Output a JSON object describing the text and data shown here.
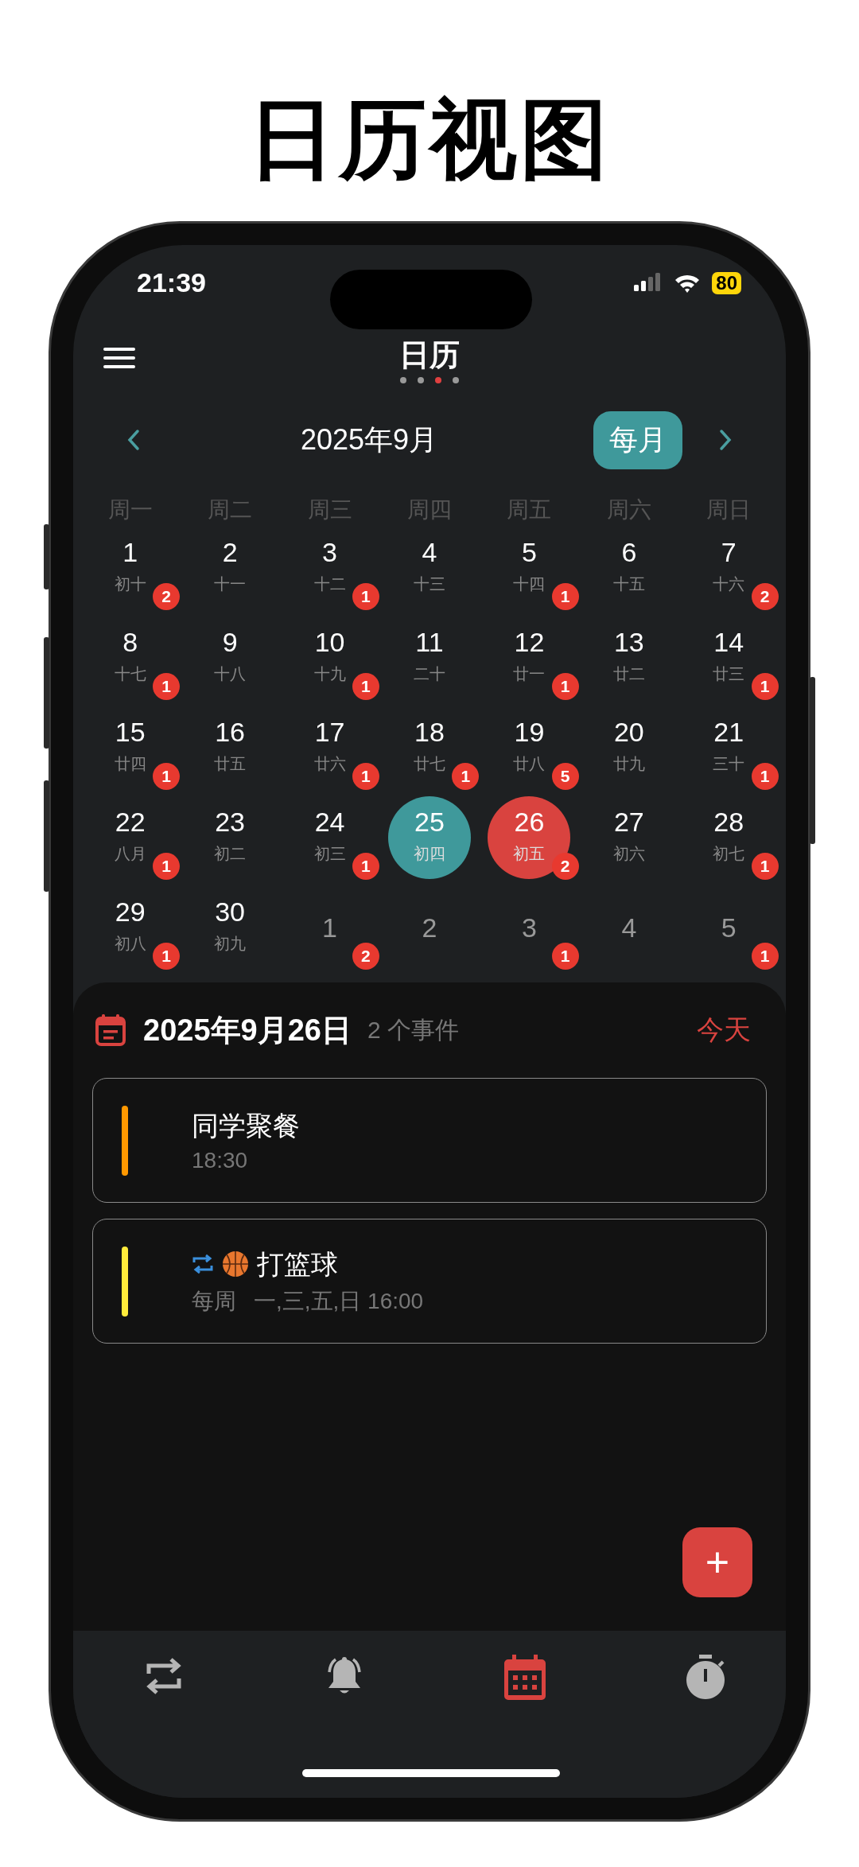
{
  "page_title": "日历视图",
  "status_bar": {
    "time": "21:39",
    "battery": "80"
  },
  "header": {
    "title": "日历",
    "page_dots": [
      {
        "selected": false
      },
      {
        "selected": false
      },
      {
        "selected": true
      },
      {
        "selected": false
      }
    ]
  },
  "month_nav": {
    "month": "2025年9月",
    "view_button": "每月"
  },
  "weekdays": [
    "周一",
    "周二",
    "周三",
    "周四",
    "周五",
    "周六",
    "周日"
  ],
  "days": [
    {
      "day": "1",
      "lunar": "初十",
      "badge": "2",
      "in_month": true,
      "today": false,
      "selected": false
    },
    {
      "day": "2",
      "lunar": "十一",
      "in_month": true,
      "today": false,
      "selected": false
    },
    {
      "day": "3",
      "lunar": "十二",
      "badge": "1",
      "in_month": true,
      "today": false,
      "selected": false
    },
    {
      "day": "4",
      "lunar": "十三",
      "in_month": true,
      "today": false,
      "selected": false
    },
    {
      "day": "5",
      "lunar": "十四",
      "badge": "1",
      "in_month": true,
      "today": false,
      "selected": false
    },
    {
      "day": "6",
      "lunar": "十五",
      "in_month": true,
      "today": false,
      "selected": false
    },
    {
      "day": "7",
      "lunar": "十六",
      "badge": "2",
      "in_month": true,
      "today": false,
      "selected": false
    },
    {
      "day": "8",
      "lunar": "十七",
      "badge": "1",
      "in_month": true,
      "today": false,
      "selected": false
    },
    {
      "day": "9",
      "lunar": "十八",
      "in_month": true,
      "today": false,
      "selected": false
    },
    {
      "day": "10",
      "lunar": "十九",
      "badge": "1",
      "in_month": true,
      "today": false,
      "selected": false
    },
    {
      "day": "11",
      "lunar": "二十",
      "in_month": true,
      "today": false,
      "selected": false
    },
    {
      "day": "12",
      "lunar": "廿一",
      "badge": "1",
      "in_month": true,
      "today": false,
      "selected": false
    },
    {
      "day": "13",
      "lunar": "廿二",
      "in_month": true,
      "today": false,
      "selected": false
    },
    {
      "day": "14",
      "lunar": "廿三",
      "badge": "1",
      "in_month": true,
      "today": false,
      "selected": false
    },
    {
      "day": "15",
      "lunar": "廿四",
      "badge": "1",
      "in_month": true,
      "today": false,
      "selected": false
    },
    {
      "day": "16",
      "lunar": "廿五",
      "in_month": true,
      "today": false,
      "selected": false
    },
    {
      "day": "17",
      "lunar": "廿六",
      "badge": "1",
      "in_month": true,
      "today": false,
      "selected": false
    },
    {
      "day": "18",
      "lunar": "廿七",
      "badge": "1",
      "in_month": true,
      "today": false,
      "selected": false
    },
    {
      "day": "19",
      "lunar": "廿八",
      "badge": "5",
      "in_month": true,
      "today": false,
      "selected": false
    },
    {
      "day": "20",
      "lunar": "廿九",
      "in_month": true,
      "today": false,
      "selected": false
    },
    {
      "day": "21",
      "lunar": "三十",
      "badge": "1",
      "in_month": true,
      "today": false,
      "selected": false
    },
    {
      "day": "22",
      "lunar": "八月",
      "badge": "1",
      "in_month": true,
      "today": false,
      "selected": false
    },
    {
      "day": "23",
      "lunar": "初二",
      "in_month": true,
      "today": false,
      "selected": false
    },
    {
      "day": "24",
      "lunar": "初三",
      "badge": "1",
      "in_month": true,
      "today": false,
      "selected": false
    },
    {
      "day": "25",
      "lunar": "初四",
      "in_month": true,
      "today": true,
      "selected": false
    },
    {
      "day": "26",
      "lunar": "初五",
      "badge": "2",
      "in_month": true,
      "today": false,
      "selected": true
    },
    {
      "day": "27",
      "lunar": "初六",
      "in_month": true,
      "today": false,
      "selected": false
    },
    {
      "day": "28",
      "lunar": "初七",
      "badge": "1",
      "in_month": true,
      "today": false,
      "selected": false
    },
    {
      "day": "29",
      "lunar": "初八",
      "badge": "1",
      "in_month": true,
      "today": false,
      "selected": false
    },
    {
      "day": "30",
      "lunar": "初九",
      "in_month": true,
      "today": false,
      "selected": false
    },
    {
      "day": "1",
      "badge": "2",
      "in_month": false,
      "today": false,
      "selected": false
    },
    {
      "day": "2",
      "in_month": false,
      "today": false,
      "selected": false
    },
    {
      "day": "3",
      "badge": "1",
      "in_month": false,
      "today": false,
      "selected": false
    },
    {
      "day": "4",
      "in_month": false,
      "today": false,
      "selected": false
    },
    {
      "day": "5",
      "badge": "1",
      "in_month": false,
      "today": false,
      "selected": false
    }
  ],
  "detail": {
    "date": "2025年9月26日",
    "count": "2 个事件",
    "today_button": "今天",
    "events": [
      {
        "kind": "plain",
        "title": "同学聚餐",
        "time": "18:30",
        "color": "#ff9800",
        "repeat": false
      },
      {
        "kind": "emoji",
        "title": "打篮球",
        "repeat_label": "每周",
        "time": "一,三,五,日 16:00",
        "color": "#ffeb3b",
        "repeat": true
      }
    ]
  },
  "fab": "+",
  "tab_bar": [
    {
      "kind": "repeat",
      "selected": false
    },
    {
      "kind": "alarm",
      "selected": false
    },
    {
      "kind": "calendar",
      "selected": true
    },
    {
      "kind": "timer",
      "selected": false
    }
  ]
}
